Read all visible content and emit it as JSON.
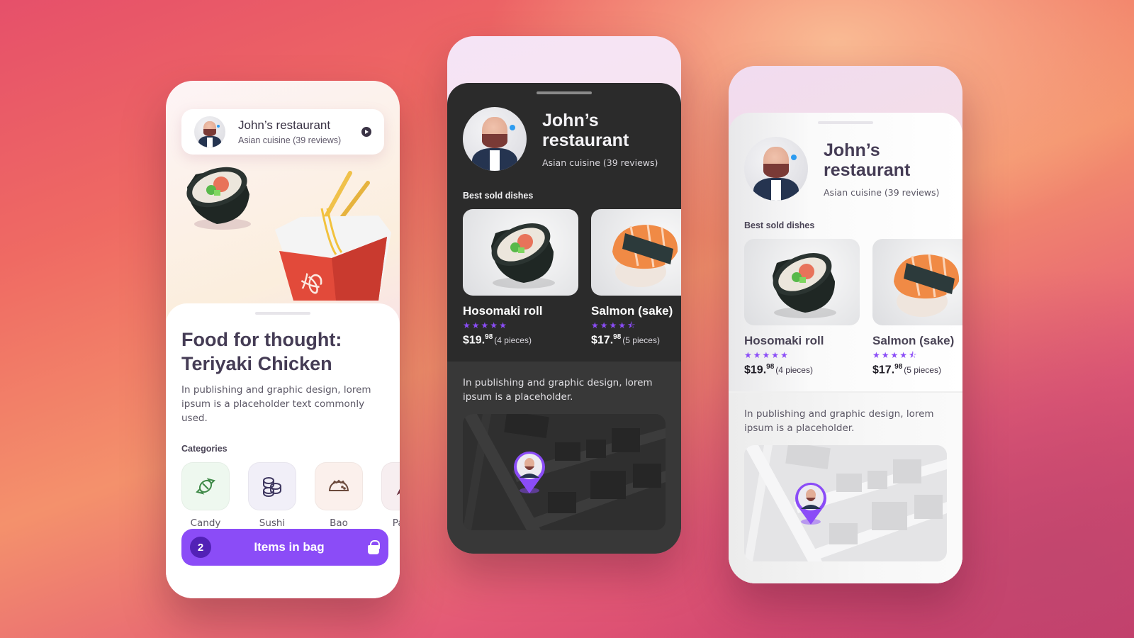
{
  "restaurant": {
    "name": "John’s restaurant",
    "name_line1": "John’s",
    "name_line2": "restaurant",
    "subtitle": "Asian cuisine (39 reviews)"
  },
  "phone1": {
    "title_line1": "Food for thought:",
    "title_line2": "Teriyaki Chicken",
    "description": "In publishing and graphic design, lorem ipsum is a placeholder text commonly used.",
    "categories_label": "Categories",
    "categories": [
      {
        "label": "Candy",
        "icon": "candy-icon",
        "bg": "#eef8ef",
        "color": "#3f8a48"
      },
      {
        "label": "Sushi",
        "icon": "sushi-icon",
        "bg": "#f1eff8",
        "color": "#3e3760"
      },
      {
        "label": "Bao",
        "icon": "bao-icon",
        "bg": "#fbf0ec",
        "color": "#6b4a3c"
      },
      {
        "label": "Pasta",
        "icon": "pasta-icon",
        "bg": "#f7eef0",
        "color": "#6a3240"
      }
    ],
    "bag": {
      "count": "2",
      "label": "Items in bag",
      "icon": "shopping-bag-icon"
    }
  },
  "best_sold_label": "Best sold dishes",
  "dishes": [
    {
      "name": "Hosomaki roll",
      "rating": 5,
      "price_main": "$19.",
      "price_cents": "98",
      "pieces": "(4 pieces)"
    },
    {
      "name": "Salmon (sake)",
      "rating": 4.5,
      "price_main": "$17.",
      "price_cents": "98",
      "pieces": "(5 pieces)"
    }
  ],
  "lower_description": "In publishing and graphic design, lorem ipsum is a placeholder.",
  "colors": {
    "accent": "#8b4cf7",
    "accent_dark": "#5221b6",
    "dark_surface": "#2b2b2b",
    "text_primary": "#453c55"
  }
}
